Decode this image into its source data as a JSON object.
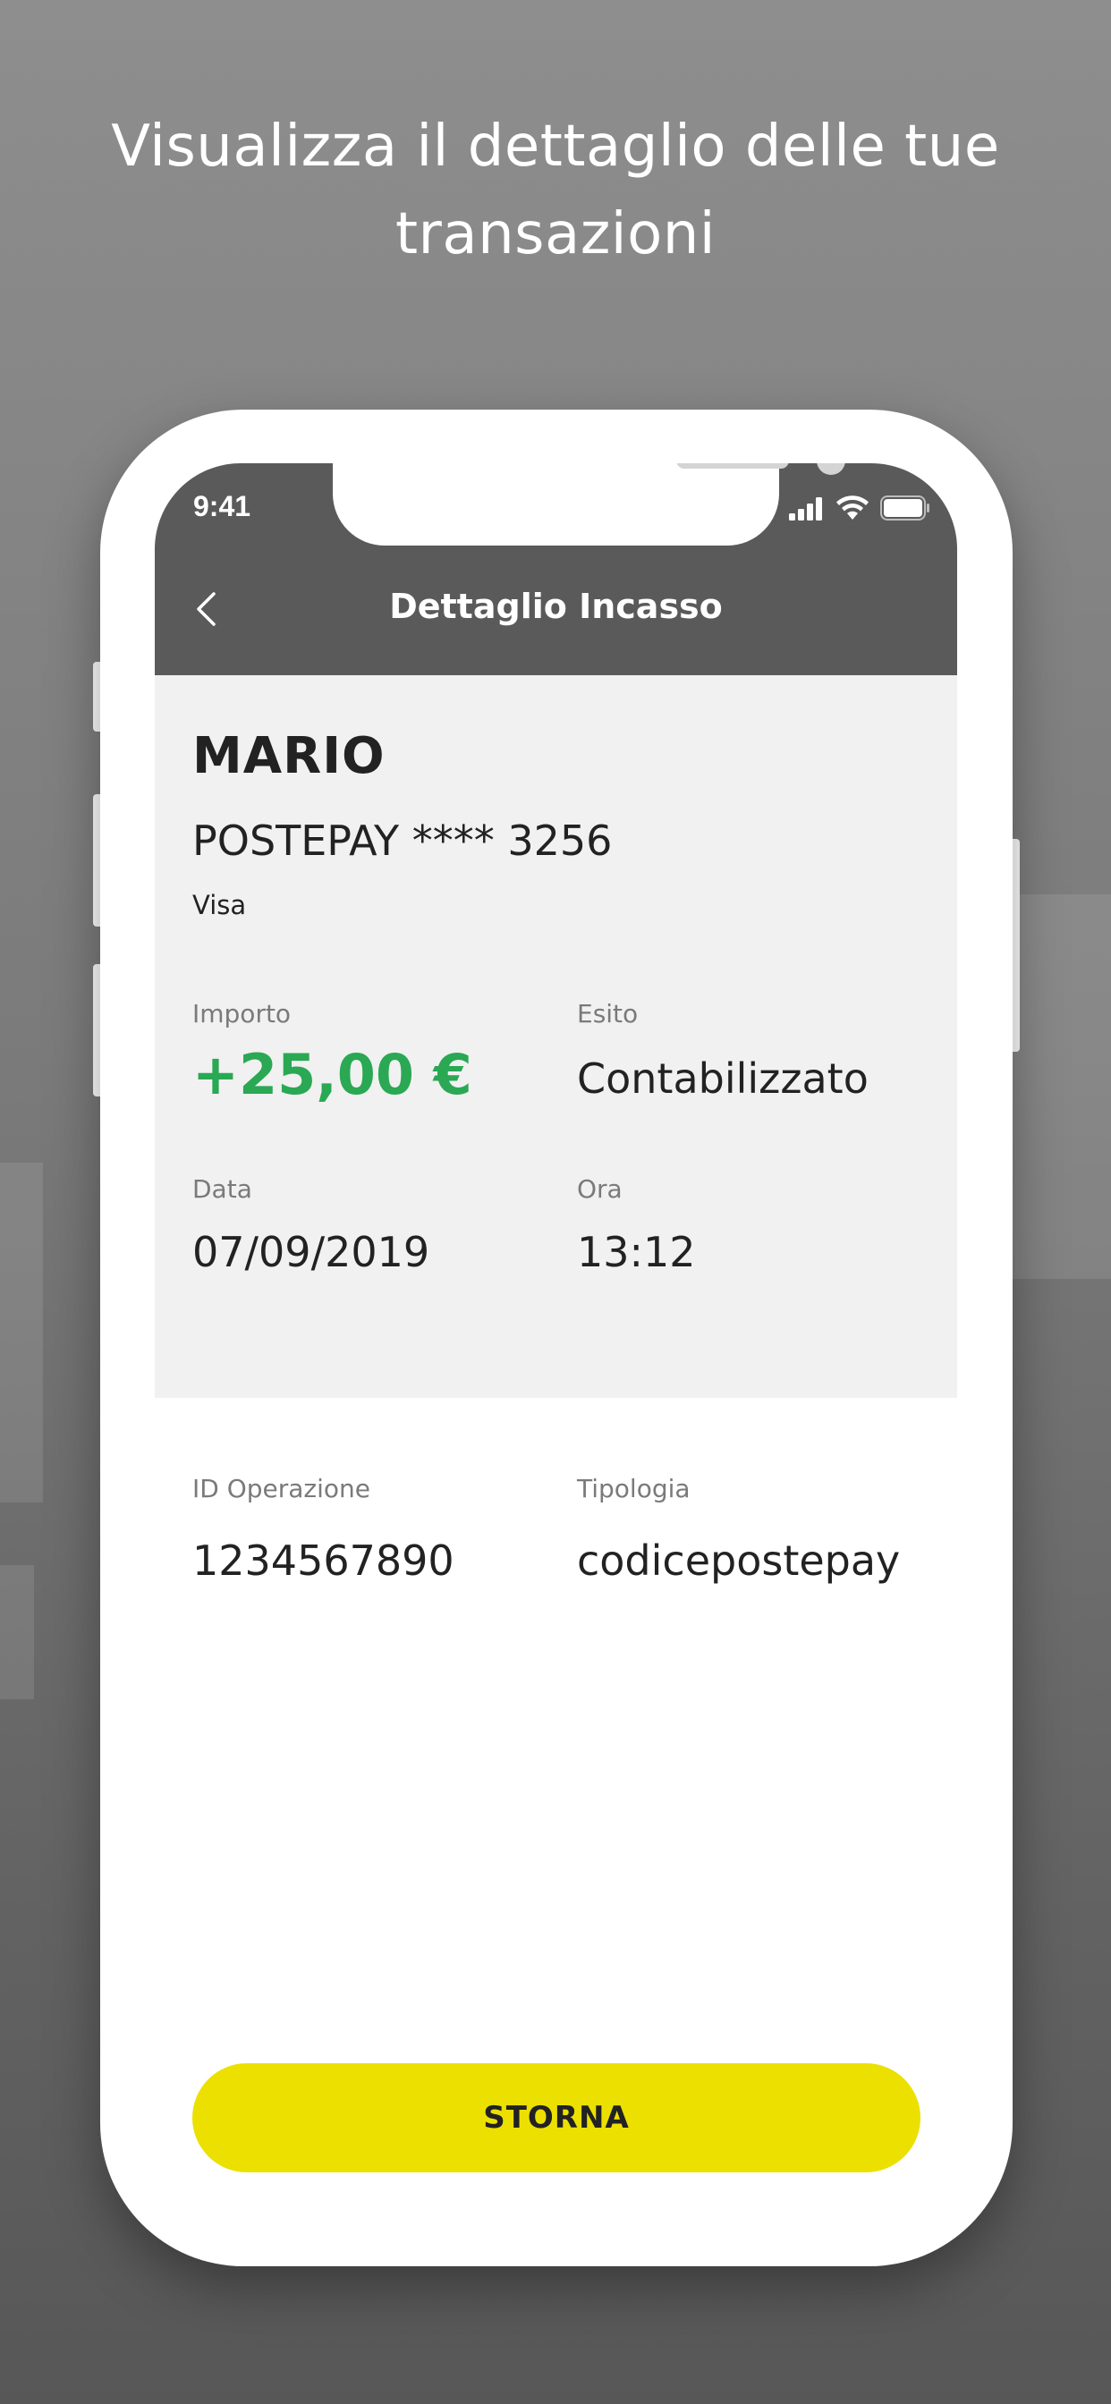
{
  "promo": {
    "headline": "Visualizza il dettaglio delle tue transazioni"
  },
  "status_bar": {
    "time": "9:41"
  },
  "nav": {
    "back_icon": "chevron-left-icon",
    "title": "Dettaglio Incasso"
  },
  "transaction": {
    "customer_name": "MARIO",
    "card_label": "POSTEPAY **** 3256",
    "card_circuit": "Visa",
    "amount_label": "Importo",
    "amount_value": "+25,00 €",
    "outcome_label": "Esito",
    "outcome_value": "Contabilizzato",
    "date_label": "Data",
    "date_value": "07/09/2019",
    "time_label": "Ora",
    "time_value": "13:12"
  },
  "details": {
    "operation_id_label": "ID Operazione",
    "operation_id_value": "1234567890",
    "type_label": "Tipologia",
    "type_value": "codicepostepay"
  },
  "actions": {
    "storna_label": "STORNA"
  },
  "colors": {
    "header_bg": "#5a5a5a",
    "summary_bg": "#f1f1f1",
    "amount_green": "#2aa854",
    "button_yellow": "#ece000"
  }
}
